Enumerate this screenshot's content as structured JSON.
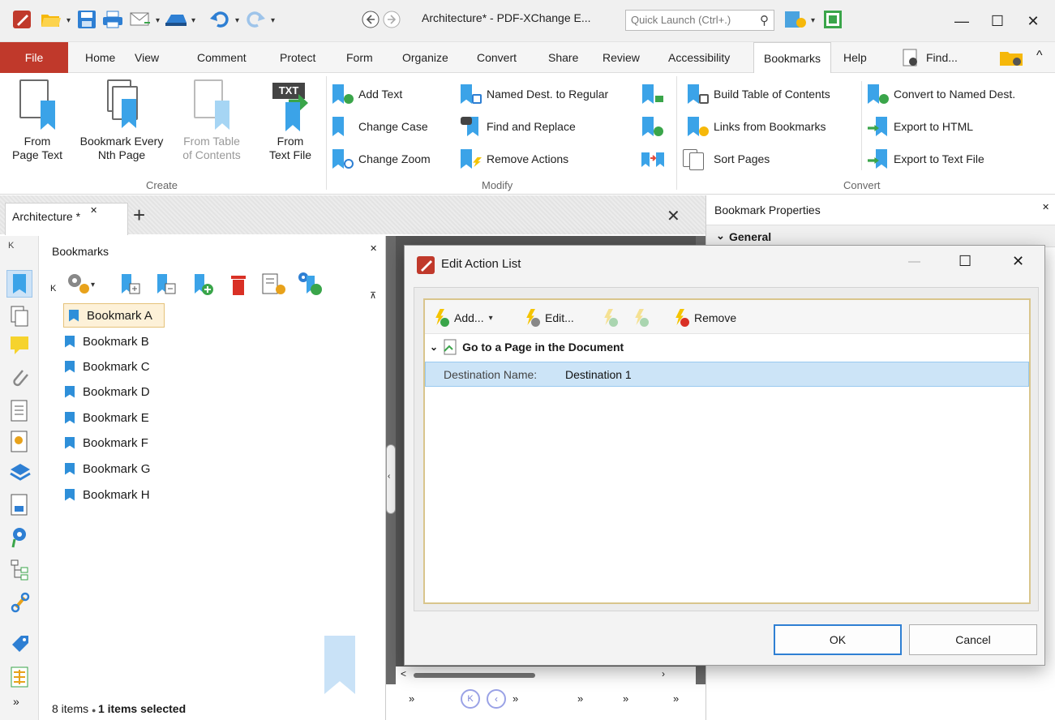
{
  "window": {
    "title": "Architecture* - PDF-XChange E...",
    "quick_launch_placeholder": "Quick Launch (Ctrl+.)"
  },
  "menu": {
    "file": "File",
    "home": "Home",
    "view": "View",
    "comment": "Comment",
    "protect": "Protect",
    "form": "Form",
    "organize": "Organize",
    "convert": "Convert",
    "share": "Share",
    "review": "Review",
    "accessibility": "Accessibility",
    "bookmarks": "Bookmarks",
    "help": "Help",
    "find": "Find..."
  },
  "ribbon": {
    "create": {
      "label": "Create",
      "from_page_text": [
        "From",
        "Page Text"
      ],
      "bookmark_every": [
        "Bookmark Every",
        "Nth Page"
      ],
      "from_toc": [
        "From Table",
        "of Contents"
      ],
      "from_text_file": [
        "From",
        "Text File"
      ]
    },
    "modify": {
      "label": "Modify",
      "add_text": "Add Text",
      "change_case": "Change Case",
      "change_zoom": "Change Zoom",
      "named_dest": "Named Dest. to Regular",
      "find_replace": "Find and Replace",
      "remove_actions": "Remove Actions"
    },
    "convert": {
      "label": "Convert",
      "build_toc": "Build Table of Contents",
      "links_from_bookmarks": "Links from Bookmarks",
      "sort_pages": "Sort Pages",
      "convert_named": "Convert to Named Dest.",
      "export_html": "Export to HTML",
      "export_text": "Export to Text File"
    }
  },
  "doc_tab": {
    "label": "Architecture *"
  },
  "bookmarks_panel": {
    "title": "Bookmarks",
    "items": [
      "Bookmark A",
      "Bookmark B",
      "Bookmark C",
      "Bookmark D",
      "Bookmark E",
      "Bookmark F",
      "Bookmark G",
      "Bookmark H"
    ],
    "selected_index": 0,
    "status_count": "8 items",
    "status_selected": "1 items selected"
  },
  "properties_panel": {
    "title": "Bookmark Properties",
    "section": "General"
  },
  "dialog": {
    "title": "Edit Action List",
    "toolbar": {
      "add": "Add...",
      "edit": "Edit...",
      "remove": "Remove"
    },
    "group": "Go to a Page in the Document",
    "row_key": "Destination Name:",
    "row_value": "Destination 1",
    "ok": "OK",
    "cancel": "Cancel"
  },
  "colors": {
    "accent_red": "#c0392b",
    "bookmark_blue": "#3ba3e8",
    "selection": "#cce4f7"
  }
}
